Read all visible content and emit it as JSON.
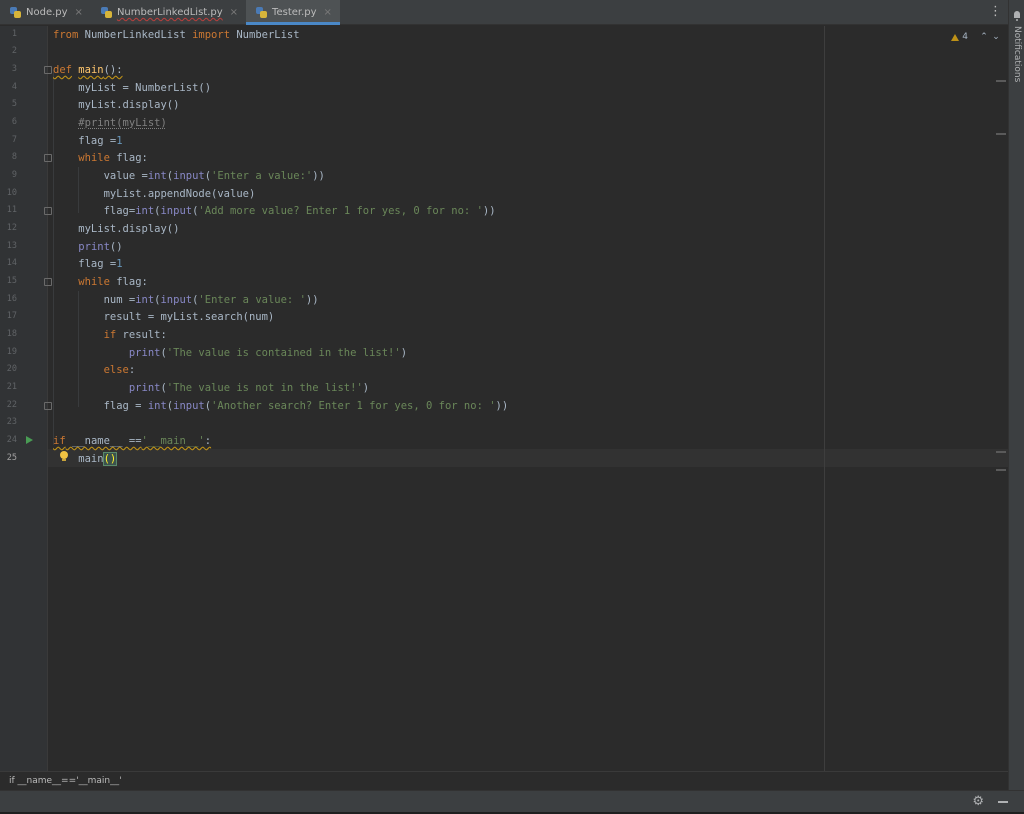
{
  "tabs": [
    {
      "label": "Node.py",
      "active": false,
      "underlined": false
    },
    {
      "label": "NumberLinkedList.py",
      "active": false,
      "underlined": true
    },
    {
      "label": "Tester.py",
      "active": true,
      "underlined": false
    }
  ],
  "editor": {
    "warnings_count": "4",
    "line_numbers": [
      "1",
      "2",
      "3",
      "4",
      "5",
      "6",
      "7",
      "8",
      "9",
      "10",
      "11",
      "12",
      "13",
      "14",
      "15",
      "16",
      "17",
      "18",
      "19",
      "20",
      "21",
      "22",
      "23",
      "24",
      "25"
    ],
    "current_line": 25
  },
  "notifications_label": "Notifications",
  "breadcrumb": "if __name__=='__main__'",
  "icons": {
    "tab_menu": "more-vertical-icon",
    "warning": "warning-triangle-icon",
    "settings": "gear-icon",
    "hide": "minimize-icon",
    "run": "run-gutter-icon",
    "intention": "lightbulb-icon"
  },
  "colors": {
    "keyword": "#cc7832",
    "string": "#6a8759",
    "number": "#6897bb",
    "function": "#ffc66d",
    "builtin": "#8888c6",
    "comment": "#808080",
    "background": "#2b2b2b"
  }
}
